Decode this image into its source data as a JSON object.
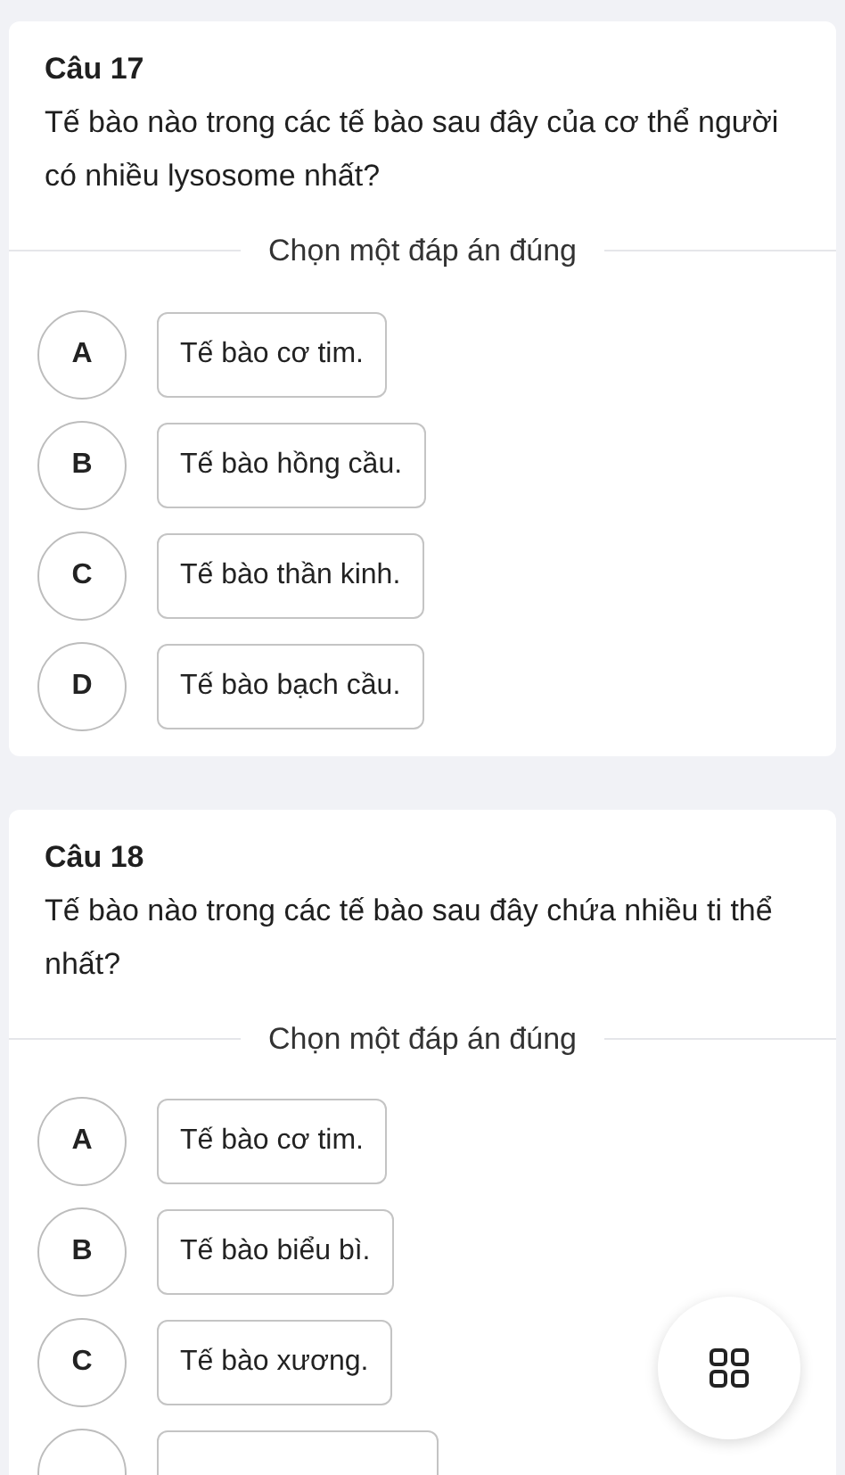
{
  "questions": [
    {
      "title": "Câu 17",
      "text": "Tế bào nào trong các tế bào sau đây của cơ thể người có nhiều lysosome nhất?",
      "instruction": "Chọn một đáp án đúng",
      "options": [
        {
          "letter": "A",
          "text": "Tế bào cơ tim."
        },
        {
          "letter": "B",
          "text": "Tế bào hồng cầu."
        },
        {
          "letter": "C",
          "text": "Tế bào thần kinh."
        },
        {
          "letter": "D",
          "text": "Tế bào bạch cầu."
        }
      ]
    },
    {
      "title": "Câu 18",
      "text": "Tế bào nào trong các tế bào sau đây chứa nhiều ti thể nhất?",
      "instruction": "Chọn một đáp án đúng",
      "options": [
        {
          "letter": "A",
          "text": "Tế bào cơ tim."
        },
        {
          "letter": "B",
          "text": "Tế bào biểu bì."
        },
        {
          "letter": "C",
          "text": "Tế bào xương."
        }
      ]
    }
  ]
}
